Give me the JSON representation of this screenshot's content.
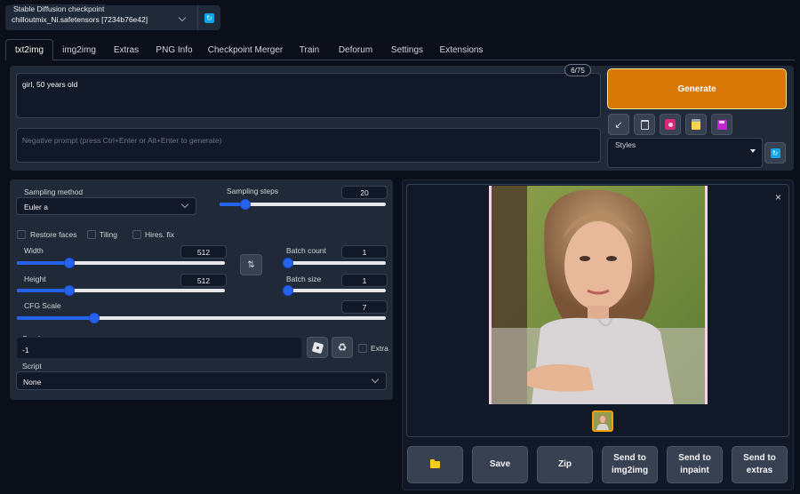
{
  "checkpoint": {
    "label": "Stable Diffusion checkpoint",
    "value": "chilloutmix_Ni.safetensors [7234b76e42]"
  },
  "tabs": [
    "txt2img",
    "img2img",
    "Extras",
    "PNG Info",
    "Checkpoint Merger",
    "Train",
    "Deforum",
    "Settings",
    "Extensions"
  ],
  "prompt": {
    "value": "girl, 50 years old",
    "token_count": "6/75",
    "negative_placeholder": "Negative prompt (press Ctrl+Enter or Alt+Enter to generate)"
  },
  "generate_label": "Generate",
  "styles_label": "Styles",
  "sampling": {
    "method_label": "Sampling method",
    "method_value": "Euler a",
    "steps_label": "Sampling steps",
    "steps_value": "20",
    "steps_fraction": 0.13
  },
  "options": {
    "restore_faces": "Restore faces",
    "tiling": "Tiling",
    "hires_fix": "Hires. fix"
  },
  "width": {
    "label": "Width",
    "value": "512",
    "fraction": 0.24
  },
  "height": {
    "label": "Height",
    "value": "512",
    "fraction": 0.24
  },
  "batch_count": {
    "label": "Batch count",
    "value": "1",
    "fraction": 0.0
  },
  "batch_size": {
    "label": "Batch size",
    "value": "1",
    "fraction": 0.0
  },
  "cfg": {
    "label": "CFG Scale",
    "value": "7",
    "fraction": 0.2
  },
  "seed": {
    "label": "Seed",
    "value": "-1",
    "extra_label": "Extra"
  },
  "script": {
    "label": "Script",
    "value": "None"
  },
  "output_buttons": {
    "save": "Save",
    "zip": "Zip",
    "send_img2img": "Send to\nimg2img",
    "send_inpaint": "Send to\ninpaint",
    "send_extras": "Send to\nextras"
  },
  "icons": {
    "refresh": "refresh-icon",
    "folder": "folder-icon",
    "dice": "dice-icon",
    "recycle": "recycle-icon",
    "close": "close-icon",
    "swap": "swap-icon"
  },
  "colors": {
    "background": "#0b0f19",
    "panel": "#1f2937",
    "generate": "#d97706",
    "slider": "#2563eb"
  }
}
